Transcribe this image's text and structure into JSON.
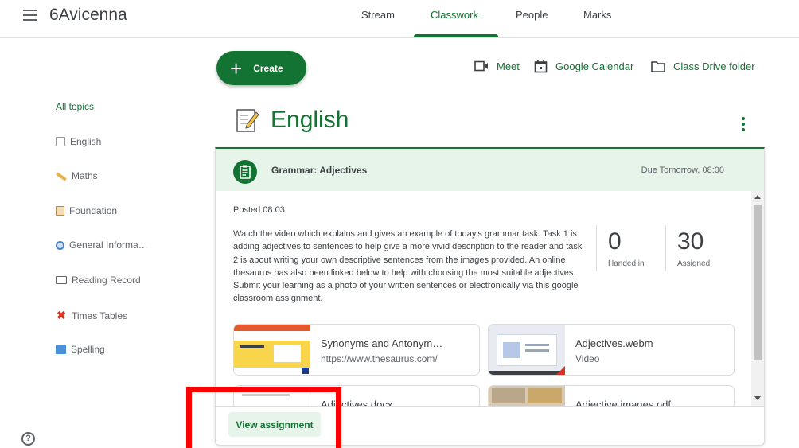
{
  "app": {
    "title": "6Avicenna"
  },
  "tabs": [
    {
      "label": "Stream"
    },
    {
      "label": "Classwork"
    },
    {
      "label": "People"
    },
    {
      "label": "Marks"
    }
  ],
  "toolbar": {
    "create_label": "Create",
    "meet_label": "Meet",
    "calendar_label": "Google Calendar",
    "drive_label": "Class Drive folder"
  },
  "sidebar": {
    "items": [
      {
        "label": "All topics",
        "icon": "none"
      },
      {
        "label": "English",
        "icon": "memo-icon"
      },
      {
        "label": "Maths",
        "icon": "ruler-icon"
      },
      {
        "label": "Foundation",
        "icon": "scroll-icon"
      },
      {
        "label": "General Informa…",
        "icon": "magnifier-icon"
      },
      {
        "label": "Reading Record",
        "icon": "tablet-icon"
      },
      {
        "label": "Times Tables",
        "icon": "cross-mark-icon"
      },
      {
        "label": "Spelling",
        "icon": "image-icon"
      }
    ]
  },
  "topic": {
    "title": "English"
  },
  "assignment": {
    "title": "Grammar: Adjectives",
    "due": "Due Tomorrow, 08:00",
    "posted": "Posted 08:03",
    "description": "Watch the video which explains and gives an example of today's grammar task. Task 1 is adding adjectives to sentences to help give a more vivid description to the reader and task 2 is about writing your own descriptive sentences from the images provided. An online thesaurus has also been linked below to help with choosing the most suitable adjectives. Submit your learning as a photo of your written sentences or electronically via this google classroom assignment.",
    "handed_in": "0",
    "handed_in_label": "Handed in",
    "assigned": "30",
    "assigned_label": "Assigned",
    "attachments": [
      {
        "name": "Synonyms and Antonym…",
        "sub": "https://www.thesaurus.com/"
      },
      {
        "name": "Adjectives.webm",
        "sub": "Video"
      },
      {
        "name": "Adjectives.docx",
        "sub": ""
      },
      {
        "name": "Adjective images.pdf",
        "sub": ""
      }
    ],
    "view_label": "View assignment"
  },
  "colors": {
    "accent": "#137333",
    "accent_light": "#e6f4ea",
    "highlight": "#ff0000"
  }
}
